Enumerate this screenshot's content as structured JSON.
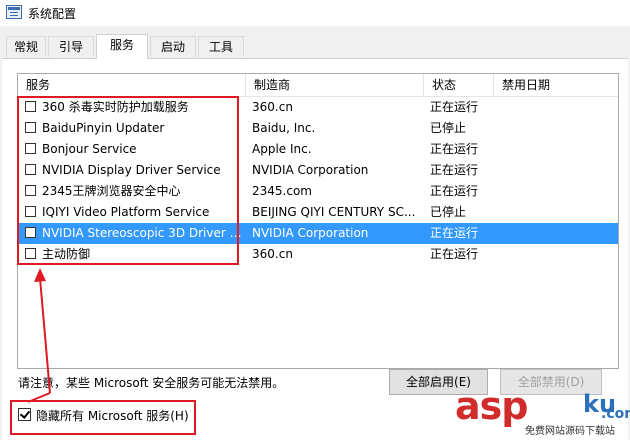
{
  "window": {
    "title": "系统配置"
  },
  "tabs": [
    {
      "label": "常规"
    },
    {
      "label": "引导"
    },
    {
      "label": "服务",
      "active": true
    },
    {
      "label": "启动"
    },
    {
      "label": "工具"
    }
  ],
  "list": {
    "columns": [
      "服务",
      "制造商",
      "状态",
      "禁用日期"
    ],
    "rows": [
      {
        "service": "360 杀毒实时防护加载服务",
        "maker": "360.cn",
        "status": "正在运行",
        "checked": false
      },
      {
        "service": "BaiduPinyin Updater",
        "maker": "Baidu, Inc.",
        "status": "已停止",
        "checked": false
      },
      {
        "service": "Bonjour Service",
        "maker": "Apple Inc.",
        "status": "正在运行",
        "checked": false
      },
      {
        "service": "NVIDIA Display Driver Service",
        "maker": "NVIDIA Corporation",
        "status": "正在运行",
        "checked": false
      },
      {
        "service": "2345王牌浏览器安全中心",
        "maker": "2345.com",
        "status": "正在运行",
        "checked": false
      },
      {
        "service": "IQIYI Video Platform Service",
        "maker": "BEIJING QIYI CENTURY SC...",
        "status": "已停止",
        "checked": false
      },
      {
        "service": "NVIDIA Stereoscopic 3D Driver S...",
        "maker": "NVIDIA Corporation",
        "status": "正在运行",
        "checked": false,
        "selected": true
      },
      {
        "service": "主动防御",
        "maker": "360.cn",
        "status": "正在运行",
        "checked": false
      }
    ]
  },
  "footer": {
    "note": "请注意，某些 Microsoft 安全服务可能无法禁用。",
    "enable_all": "全部启用(E)",
    "disable_all": "全部禁用(D)",
    "hide_ms": "隐藏所有 Microsoft 服务(H)",
    "hide_ms_checked": true
  },
  "watermark": {
    "brand": "asp",
    "domain": "ku",
    "tld": ".com",
    "tagline": "免费网站源码下载站"
  },
  "colors": {
    "selection": "#3399ff",
    "annotation": "#e01a22"
  }
}
